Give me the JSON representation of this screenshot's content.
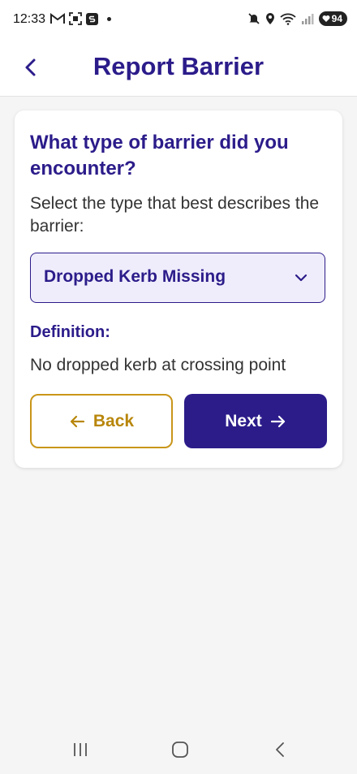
{
  "status_bar": {
    "time": "12:33",
    "battery": "94",
    "icons": [
      "gmail-icon",
      "screenshot-icon",
      "s-app-icon",
      "mute-icon",
      "location-icon",
      "wifi-icon",
      "signal-icon",
      "battery-icon"
    ]
  },
  "header": {
    "title": "Report Barrier",
    "back_icon": "chevron-left-icon"
  },
  "card": {
    "question": "What type of barrier did you encounter?",
    "instruction": "Select the type that best describes the barrier:",
    "select": {
      "value": "Dropped Kerb Missing",
      "icon": "chevron-down-icon"
    },
    "definition_label": "Definition:",
    "definition_text": "No dropped kerb at crossing point",
    "back_button": "Back",
    "next_button": "Next"
  },
  "colors": {
    "primary": "#2b1c8a",
    "accent": "#b8860b",
    "select_bg": "#efedfb",
    "page_bg": "#f5f5f5"
  },
  "nav_bar": {
    "icons": [
      "recents-icon",
      "home-icon",
      "back-nav-icon"
    ]
  }
}
